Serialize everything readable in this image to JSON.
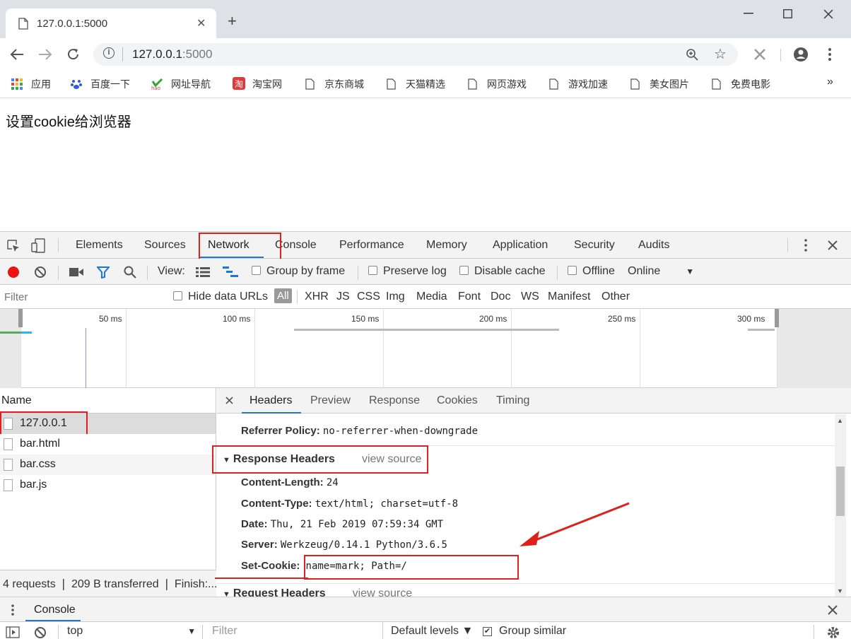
{
  "browser": {
    "tab_title": "127.0.0.1:5000",
    "url_host": "127.0.0.1",
    "url_port": ":5000",
    "bookmarks": [
      "应用",
      "百度一下",
      "网址导航",
      "淘宝网",
      "京东商城",
      "天猫精选",
      "网页游戏",
      "游戏加速",
      "美女图片",
      "免费电影"
    ],
    "more_bookmarks": "»"
  },
  "page": {
    "heading": "设置cookie给浏览器"
  },
  "devtools": {
    "tabs": [
      "Elements",
      "Sources",
      "Network",
      "Console",
      "Performance",
      "Memory",
      "Application",
      "Security",
      "Audits"
    ],
    "network_toolbar": {
      "view_label": "View:",
      "group_by_frame": "Group by frame",
      "preserve_log": "Preserve log",
      "disable_cache": "Disable cache",
      "offline": "Offline",
      "throttle": "Online"
    },
    "filter": {
      "placeholder": "Filter",
      "hide_data_urls": "Hide data URLs",
      "types": [
        "All",
        "XHR",
        "JS",
        "CSS",
        "Img",
        "Media",
        "Font",
        "Doc",
        "WS",
        "Manifest",
        "Other"
      ]
    },
    "timeline_ticks": [
      "50 ms",
      "100 ms",
      "150 ms",
      "200 ms",
      "250 ms",
      "300 ms"
    ],
    "request_list": {
      "column": "Name",
      "requests": [
        "127.0.0.1",
        "bar.html",
        "bar.css",
        "bar.js"
      ],
      "status": "4 requests  ❘  209 B transferred  ❘  Finish:..."
    },
    "detail_tabs": [
      "Headers",
      "Preview",
      "Response",
      "Cookies",
      "Timing"
    ],
    "headers": {
      "referrer_policy_label": "Referrer Policy:",
      "referrer_policy_value": "no-referrer-when-downgrade",
      "response_headers_title": "Response Headers",
      "view_source": "view source",
      "response": [
        {
          "name": "Content-Length:",
          "value": "24"
        },
        {
          "name": "Content-Type:",
          "value": "text/html; charset=utf-8"
        },
        {
          "name": "Date:",
          "value": "Thu, 21 Feb 2019 07:59:34 GMT"
        },
        {
          "name": "Server:",
          "value": "Werkzeug/0.14.1 Python/3.6.5"
        },
        {
          "name": "Set-Cookie:",
          "value": "name=mark; Path=/"
        }
      ],
      "request_headers_title": "Request Headers",
      "request_view_source": "view source"
    },
    "drawer": {
      "tab": "Console",
      "context": "top",
      "filter_placeholder": "Filter",
      "levels": "Default levels ▼",
      "group_similar": "Group similar"
    }
  },
  "colors": {
    "annotation_red": "#e0201b",
    "accent_blue": "#1a73e8",
    "record_red": "#e11"
  }
}
